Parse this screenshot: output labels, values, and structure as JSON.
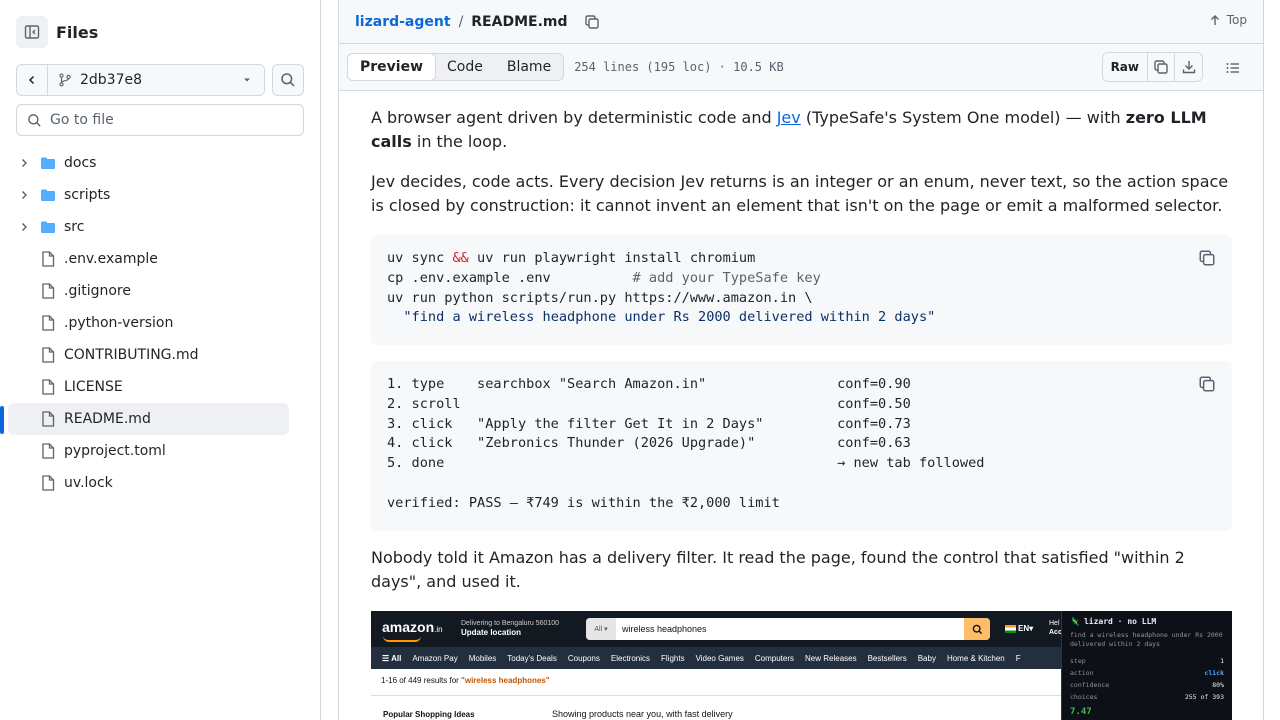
{
  "sidebar": {
    "title": "Files",
    "branch": "2db37e8",
    "goto_placeholder": "Go to file",
    "items": [
      {
        "label": "docs",
        "type": "folder"
      },
      {
        "label": "scripts",
        "type": "folder"
      },
      {
        "label": "src",
        "type": "folder"
      },
      {
        "label": ".env.example",
        "type": "file"
      },
      {
        "label": ".gitignore",
        "type": "file"
      },
      {
        "label": ".python-version",
        "type": "file"
      },
      {
        "label": "CONTRIBUTING.md",
        "type": "file"
      },
      {
        "label": "LICENSE",
        "type": "file"
      },
      {
        "label": "README.md",
        "type": "file",
        "selected": true
      },
      {
        "label": "pyproject.toml",
        "type": "file"
      },
      {
        "label": "uv.lock",
        "type": "file"
      }
    ]
  },
  "breadcrumb": {
    "repo": "lizard-agent",
    "separator": "/",
    "file": "README.md",
    "top_label": "Top"
  },
  "file_header": {
    "tabs": [
      "Preview",
      "Code",
      "Blame"
    ],
    "active_tab": "Preview",
    "meta": "254 lines (195 loc) · 10.5 KB",
    "raw_label": "Raw"
  },
  "readme": {
    "p1_before": "A browser agent driven by deterministic code and ",
    "p1_link": "Jev",
    "p1_middle": " (TypeSafe's System One model) — with ",
    "p1_bold": "zero LLM calls",
    "p1_after": " in the loop.",
    "p2": "Jev decides, code acts. Every decision Jev returns is an integer or an enum, never text, so the action space is closed by construction: it cannot invent an element that isn't on the page or emit a malformed selector.",
    "code1": {
      "l1a": "uv sync ",
      "l1op": "&&",
      "l1b": " uv run playwright install chromium",
      "l2a": "cp .env.example .env          ",
      "l2comment": "# add your TypeSafe key",
      "l3": "uv run python scripts/run.py https://www.amazon.in \\",
      "l4indent": "  ",
      "l4str": "\"find a wireless headphone under Rs 2000 delivered within 2 days\""
    },
    "code2": [
      "1. type    searchbox \"Search Amazon.in\"                conf=0.90",
      "2. scroll                                              conf=0.50",
      "3. click   \"Apply the filter Get It in 2 Days\"         conf=0.73",
      "4. click   \"Zebronics Thunder (2026 Upgrade)\"          conf=0.63",
      "5. done                                                → new tab followed",
      "",
      "verified: PASS — ₹749 is within the ₹2,000 limit"
    ],
    "p3": "Nobody told it Amazon has a delivery filter. It read the page, found the control that satisfied \"within 2 days\", and used it."
  },
  "screenshot": {
    "logo": "amazon",
    "logo_suffix": ".in",
    "deliver_line1": "Delivering to Bengaluru 560100",
    "deliver_line2": "Update location",
    "search_category": "All",
    "search_query": "wireless headphones",
    "lang": "EN",
    "hello_line1": "Hel",
    "hello_line2": "Acc",
    "nav": [
      "All",
      "Amazon Pay",
      "Mobiles",
      "Today's Deals",
      "Coupons",
      "Electronics",
      "Flights",
      "Video Games",
      "Computers",
      "New Releases",
      "Bestsellers",
      "Baby",
      "Home & Kitchen",
      "F"
    ],
    "results_prefix": "1-16 of 449 results for ",
    "results_query": "\"wireless headphones\"",
    "popular": "Popular Shopping Ideas",
    "showing": "Showing products near you, with fast delivery",
    "panel": {
      "title": "lizard · no LLM",
      "task": "find a wireless headphone under Rs 2000 delivered within 2 days",
      "rows": [
        {
          "k": "step",
          "v": "1"
        },
        {
          "k": "action",
          "v": "click"
        },
        {
          "k": "confidence",
          "v": "80%"
        },
        {
          "k": "choices",
          "v": "255 of 393"
        }
      ],
      "big": "7.47"
    }
  },
  "colors": {
    "accent": "#0969da",
    "folder": "#54aeff",
    "border": "#d1d9e0"
  }
}
